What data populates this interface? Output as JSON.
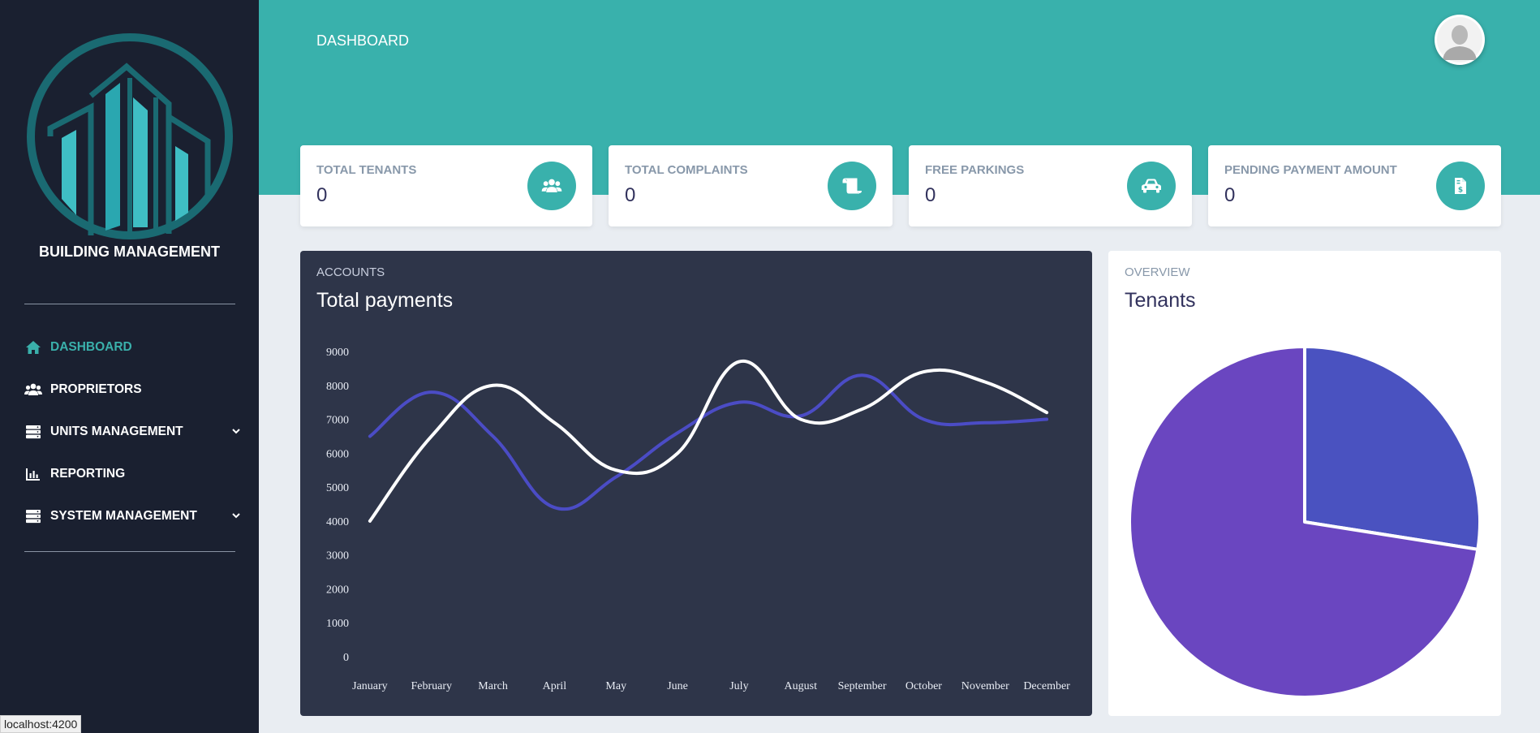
{
  "sidebar": {
    "brand": "BUILDING MANAGEMENT",
    "items": [
      {
        "label": "DASHBOARD",
        "icon": "home-icon",
        "active": true
      },
      {
        "label": "PROPRIETORS",
        "icon": "users-icon"
      },
      {
        "label": "UNITS MANAGEMENT",
        "icon": "server-icon",
        "has_submenu": true
      },
      {
        "label": "REPORTING",
        "icon": "chart-bar-icon"
      },
      {
        "label": "SYSTEM MANAGEMENT",
        "icon": "server-icon",
        "has_submenu": true
      }
    ]
  },
  "header": {
    "title": "DASHBOARD",
    "avatar_icon": "user-avatar-icon"
  },
  "stats": [
    {
      "label": "TOTAL TENANTS",
      "value": "0",
      "icon": "users-icon"
    },
    {
      "label": "TOTAL COMPLAINTS",
      "value": "0",
      "icon": "scroll-icon"
    },
    {
      "label": "FREE PARKINGS",
      "value": "0",
      "icon": "car-icon"
    },
    {
      "label": "PENDING PAYMENT AMOUNT",
      "value": "0",
      "icon": "invoice-dollar-icon"
    }
  ],
  "accounts_card": {
    "kicker": "ACCOUNTS",
    "title": "Total payments"
  },
  "overview_card": {
    "kicker": "OVERVIEW",
    "title": "Tenants"
  },
  "status_bar": {
    "url": "localhost:4200"
  },
  "colors": {
    "teal": "#39b1ac",
    "sidebar": "#1a2030",
    "chart_bg": "#2e3549",
    "series_white": "#ffffff",
    "series_blue": "#4b4cc5",
    "pie_blue": "#4a52c0",
    "pie_purple": "#6a46c0"
  },
  "chart_data": [
    {
      "type": "line",
      "title": "Total payments",
      "categories": [
        "January",
        "February",
        "March",
        "April",
        "May",
        "June",
        "July",
        "August",
        "September",
        "October",
        "November",
        "December"
      ],
      "yticks": [
        "0",
        "1000",
        "2000",
        "3000",
        "4000",
        "5000",
        "6000",
        "7000",
        "8000",
        "9000"
      ],
      "ylim": [
        0,
        9000
      ],
      "grid": false,
      "series": [
        {
          "values": [
            4000,
            6500,
            8000,
            6900,
            5500,
            6000,
            8700,
            7000,
            7300,
            8400,
            8100,
            7200
          ],
          "color": "#ffffff"
        },
        {
          "values": [
            6500,
            7800,
            6500,
            4400,
            5300,
            6600,
            7500,
            7100,
            8300,
            7000,
            6900,
            7000
          ],
          "color": "#4b4cc5"
        }
      ]
    },
    {
      "type": "pie",
      "title": "Tenants",
      "slices": [
        {
          "value": 27.5,
          "color": "#4a52c0"
        },
        {
          "value": 72.5,
          "color": "#6a46c0"
        }
      ]
    }
  ]
}
